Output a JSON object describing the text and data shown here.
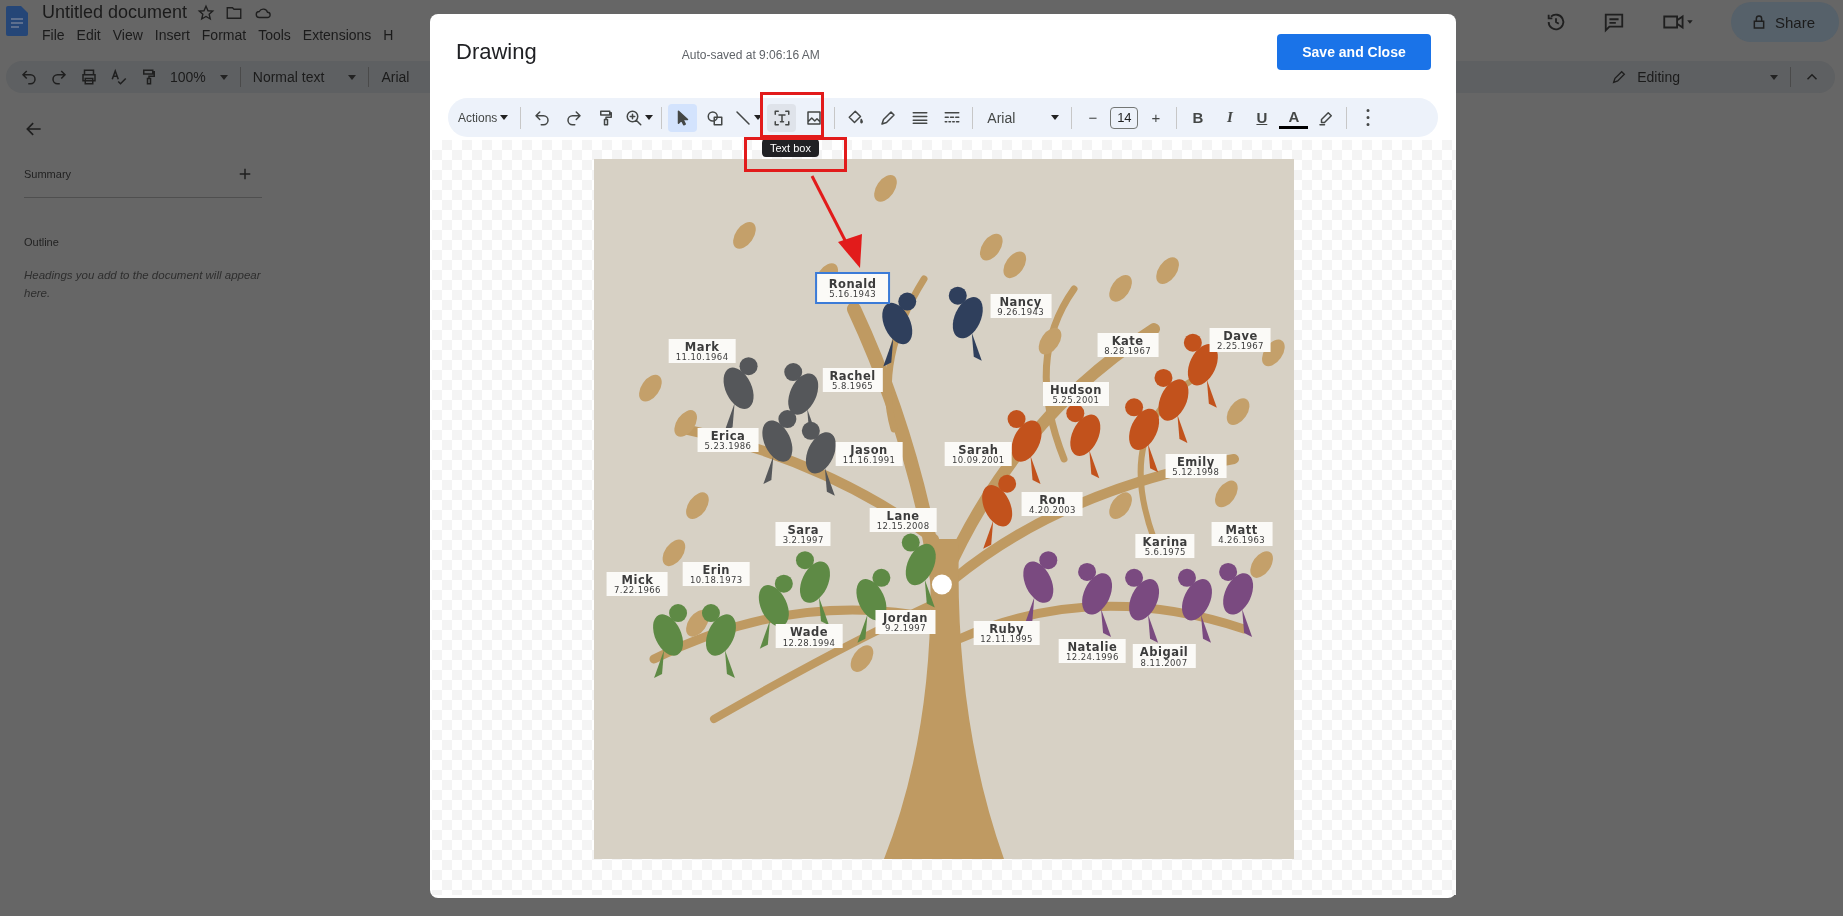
{
  "docs": {
    "title": "Untitled document",
    "menus": [
      "File",
      "Edit",
      "View",
      "Insert",
      "Format",
      "Tools",
      "Extensions",
      "H"
    ],
    "zoom": "100%",
    "style": "Normal text",
    "font": "Arial",
    "share": "Share",
    "mode": "Editing"
  },
  "sidebar": {
    "summary": "Summary",
    "outline": "Outline",
    "hint": "Headings you add to the document will appear here."
  },
  "dialog": {
    "title": "Drawing",
    "autosave": "Auto-saved at 9:06:16 AM",
    "save": "Save and Close",
    "tooltip": "Text box",
    "toolbar": [
      [
        {
          "kind": "menu",
          "label": "Actions"
        }
      ],
      [
        {
          "kind": "undo",
          "selected": false,
          "hovered": false,
          "dropdown": false
        },
        {
          "kind": "redo",
          "selected": false,
          "hovered": false,
          "dropdown": false
        },
        {
          "kind": "paint",
          "selected": false,
          "hovered": false,
          "dropdown": false
        },
        {
          "kind": "zoom",
          "selected": false,
          "hovered": false,
          "dropdown": true
        }
      ],
      [
        {
          "kind": "select",
          "selected": true,
          "hovered": false,
          "dropdown": false
        },
        {
          "kind": "shape",
          "selected": false,
          "hovered": false,
          "dropdown": false
        },
        {
          "kind": "line",
          "selected": false,
          "hovered": false,
          "dropdown": true
        },
        {
          "kind": "textbox",
          "selected": false,
          "hovered": true,
          "dropdown": false
        },
        {
          "kind": "image",
          "selected": false,
          "hovered": false,
          "dropdown": false
        }
      ],
      [
        {
          "kind": "fill",
          "selected": false,
          "hovered": false,
          "dropdown": false
        },
        {
          "kind": "pen",
          "selected": false,
          "hovered": false,
          "dropdown": false
        },
        {
          "kind": "weight",
          "selected": false,
          "hovered": false,
          "dropdown": false
        },
        {
          "kind": "dash",
          "selected": false,
          "hovered": false,
          "dropdown": false
        }
      ],
      [
        {
          "kind": "font",
          "label": "Arial"
        }
      ],
      [
        {
          "kind": "step",
          "label": "−"
        },
        {
          "kind": "size",
          "value": "14"
        },
        {
          "kind": "step",
          "label": "+"
        }
      ],
      [
        {
          "kind": "bold",
          "label": "B"
        },
        {
          "kind": "italic",
          "label": "I"
        },
        {
          "kind": "underline",
          "label": "U"
        },
        {
          "kind": "textcolor",
          "label": "A"
        },
        {
          "kind": "highlight",
          "selected": false,
          "hovered": false,
          "dropdown": false
        }
      ],
      [
        {
          "kind": "more",
          "selected": false,
          "hovered": false,
          "dropdown": false
        }
      ]
    ],
    "labels": [
      {
        "name": "Ronald",
        "date": "5.16.1943",
        "selected": true
      },
      {
        "name": "Nancy",
        "date": "9.26.1943",
        "selected": false
      },
      {
        "name": "Mark",
        "date": "11.10.1964",
        "selected": false
      },
      {
        "name": "Kate",
        "date": "8.28.1967",
        "selected": false
      },
      {
        "name": "Dave",
        "date": "2.25.1967",
        "selected": false
      },
      {
        "name": "Rachel",
        "date": "5.8.1965",
        "selected": false
      },
      {
        "name": "Hudson",
        "date": "5.25.2001",
        "selected": false
      },
      {
        "name": "Erica",
        "date": "5.23.1986",
        "selected": false
      },
      {
        "name": "Jason",
        "date": "11.16.1991",
        "selected": false
      },
      {
        "name": "Sarah",
        "date": "10.09.2001",
        "selected": false
      },
      {
        "name": "Emily",
        "date": "5.12.1998",
        "selected": false
      },
      {
        "name": "Ron",
        "date": "4.20.2003",
        "selected": false
      },
      {
        "name": "Sara",
        "date": "3.2.1997",
        "selected": false
      },
      {
        "name": "Lane",
        "date": "12.15.2008",
        "selected": false
      },
      {
        "name": "Karina",
        "date": "5.6.1975",
        "selected": false
      },
      {
        "name": "Matt",
        "date": "4.26.1963",
        "selected": false
      },
      {
        "name": "Mick",
        "date": "7.22.1966",
        "selected": false
      },
      {
        "name": "Erin",
        "date": "10.18.1973",
        "selected": false
      },
      {
        "name": "Wade",
        "date": "12.28.1994",
        "selected": false
      },
      {
        "name": "Jordan",
        "date": "9.2.1997",
        "selected": false
      },
      {
        "name": "Ruby",
        "date": "12.11.1995",
        "selected": false
      },
      {
        "name": "Natalie",
        "date": "12.24.1996",
        "selected": false
      },
      {
        "name": "Abigail",
        "date": "8.11.2007",
        "selected": false
      }
    ]
  }
}
